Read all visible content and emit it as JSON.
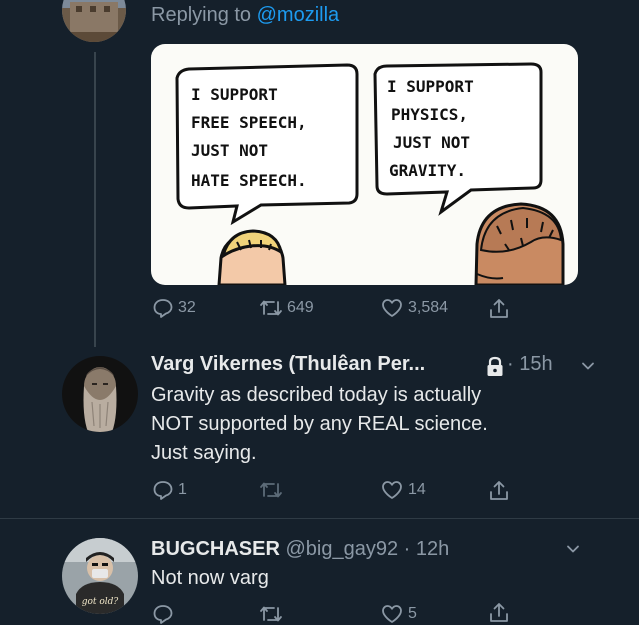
{
  "tweet1": {
    "replying_prefix": "Replying to ",
    "replying_handle": "@mozilla",
    "comic": {
      "left_line1": "I SUPPORT",
      "left_line2": "FREE SPEECH,",
      "left_line3": "JUST NOT",
      "left_line4": "HATE SPEECH.",
      "right_line1": "I SUPPORT",
      "right_line2": "PHYSICS,",
      "right_line3": "JUST NOT",
      "right_line4": "GRAVITY."
    },
    "actions": {
      "replies": "32",
      "retweets": "649",
      "likes": "3,584"
    }
  },
  "tweet2": {
    "name": "Varg Vikernes (Thulêan Per...",
    "time": "· 15h",
    "text_line1": "Gravity as described today is actually",
    "text_line2": "NOT supported by any REAL science.",
    "text_line3": "Just saying.",
    "actions": {
      "replies": "1",
      "retweets": "",
      "likes": "14"
    }
  },
  "tweet3": {
    "name": "BUGCHASER",
    "handle_time": "@big_gay92 · 12h",
    "text": "Not now varg",
    "avatar_shirt_text": "got old?",
    "actions": {
      "replies": "",
      "retweets": "",
      "likes": "5"
    }
  },
  "icons": [
    "reply-icon",
    "retweet-icon",
    "like-icon",
    "share-icon",
    "lock-icon",
    "chevron-down-icon"
  ],
  "colors": {
    "background": "#15202b",
    "accent": "#1d9bf0",
    "muted": "#8b98a5",
    "text": "#e7e9ea"
  }
}
